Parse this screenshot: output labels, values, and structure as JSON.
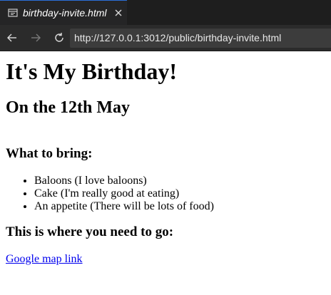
{
  "tab": {
    "title": "birthday-invite.html",
    "icon": "preview-icon",
    "close_icon": "close-icon"
  },
  "nav": {
    "back_icon": "back-arrow-icon",
    "forward_icon": "forward-arrow-icon",
    "reload_icon": "reload-icon",
    "url": "http://127.0.0.1:3012/public/birthday-invite.html"
  },
  "page": {
    "heading": "It's My Birthday!",
    "date": "On the 12th May",
    "bring_heading": "What to bring:",
    "bring_items": [
      "Baloons (I love baloons)",
      "Cake (I'm really good at eating)",
      "An appetite (There will be lots of food)"
    ],
    "where_heading": "This is where you need to go:",
    "map_link": "Google map link"
  },
  "colors": {
    "link": "#0000ee",
    "tab_accent": "#2a6fd8",
    "chrome_bg": "#1e1e1e"
  }
}
